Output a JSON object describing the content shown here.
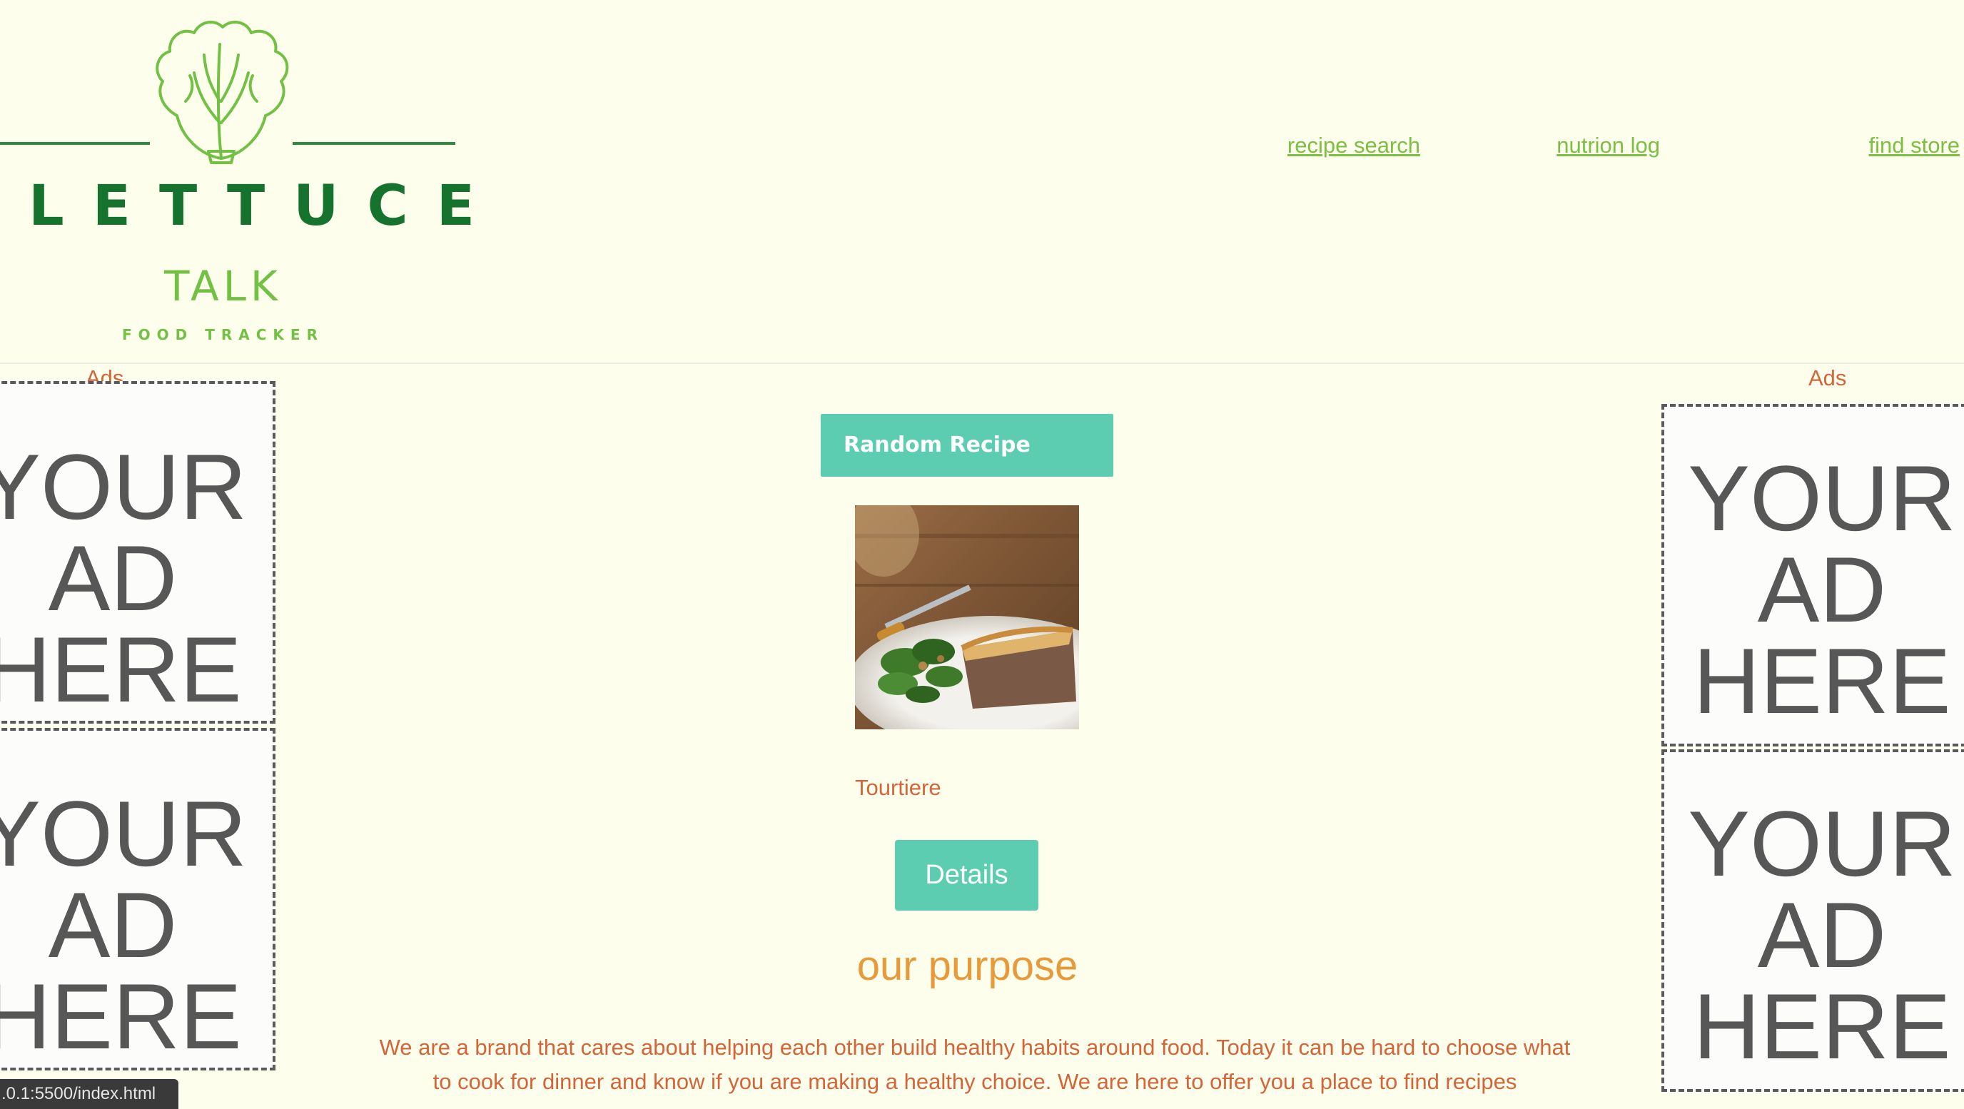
{
  "brand": {
    "word": "LETTUCE",
    "talk": "TALK",
    "tagline": "FOOD TRACKER",
    "colors": {
      "dark_green": "#15732e",
      "light_green": "#72c044"
    }
  },
  "nav": {
    "items": [
      {
        "label": "recipe search"
      },
      {
        "label": "nutrion log"
      },
      {
        "label": "find store"
      }
    ]
  },
  "ads_left": {
    "title": "Ads",
    "ads": [
      {
        "text": "YOUR\nAD\nHERE"
      },
      {
        "text": "YOUR\nAD\nHERE"
      }
    ]
  },
  "ads_right": {
    "title": "Ads",
    "ads": [
      {
        "text": "YOUR\nAD\nHERE"
      },
      {
        "text": "YOUR\nAD\nHERE"
      }
    ]
  },
  "main": {
    "random_button": "Random Recipe",
    "recipe_name": "Tourtiere",
    "details_button": "Details",
    "purpose_title": "our purpose",
    "purpose_text": "We are a brand that cares about helping each other build healthy habits around food. Today it can be hard to choose what to cook for dinner and know if you are making a healthy choice. We are here to offer you a place to find recipes"
  },
  "status_bar": {
    "url": ".0.1:5500/index.html"
  },
  "theme": {
    "background": "#fefeec",
    "accent_teal": "#5ccdb0",
    "text_orange": "#d3653a",
    "title_orange": "#e89a3a",
    "link_green": "#7cbf44"
  }
}
